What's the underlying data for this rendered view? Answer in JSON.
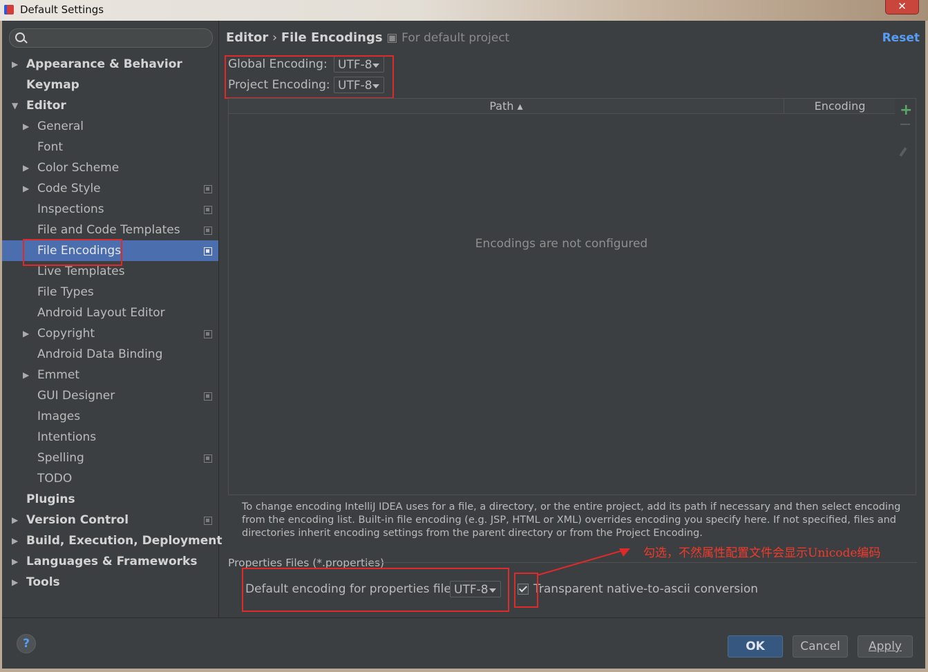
{
  "window": {
    "title": "Default Settings",
    "close_glyph": "✕"
  },
  "sidebar": {
    "search_placeholder": "",
    "items": [
      {
        "label": "Appearance & Behavior"
      },
      {
        "label": "Keymap"
      },
      {
        "label": "Editor"
      },
      {
        "label": "General"
      },
      {
        "label": "Font"
      },
      {
        "label": "Color Scheme"
      },
      {
        "label": "Code Style"
      },
      {
        "label": "Inspections"
      },
      {
        "label": "File and Code Templates"
      },
      {
        "label": "File Encodings"
      },
      {
        "label": "Live Templates"
      },
      {
        "label": "File Types"
      },
      {
        "label": "Android Layout Editor"
      },
      {
        "label": "Copyright"
      },
      {
        "label": "Android Data Binding"
      },
      {
        "label": "Emmet"
      },
      {
        "label": "GUI Designer"
      },
      {
        "label": "Images"
      },
      {
        "label": "Intentions"
      },
      {
        "label": "Spelling"
      },
      {
        "label": "TODO"
      },
      {
        "label": "Plugins"
      },
      {
        "label": "Version Control"
      },
      {
        "label": "Build, Execution, Deployment"
      },
      {
        "label": "Languages & Frameworks"
      },
      {
        "label": "Tools"
      }
    ],
    "selected": "File Encodings"
  },
  "breadcrumb": {
    "parent": "Editor",
    "separator": "›",
    "current": "File Encodings",
    "scope": "For default project"
  },
  "reset_label": "Reset",
  "encodings": {
    "global_label": "Global Encoding:",
    "global_value": "UTF-8",
    "project_label": "Project Encoding:",
    "project_value": "UTF-8"
  },
  "table": {
    "col_path": "Path",
    "col_path_sort": "▴",
    "col_encoding": "Encoding",
    "empty_message": "Encodings are not configured"
  },
  "help_text": "To change encoding IntelliJ IDEA uses for a file, a directory, or the entire project, add its path if necessary and then select encoding from the encoding list. Built-in file encoding (e.g. JSP, HTML or XML) overrides encoding you specify here. If not specified, files and directories inherit encoding settings from the parent directory or from the Project Encoding.",
  "properties": {
    "section_title": "Properties Files (*.properties)",
    "default_label": "Default encoding for properties files:",
    "default_value": "UTF-8",
    "transparent_label": "Transparent native-to-ascii conversion",
    "transparent_checked": true
  },
  "annotation": "勾选，不然属性配置文件会显示Unicode编码",
  "footer": {
    "help_glyph": "?",
    "ok": "OK",
    "cancel": "Cancel",
    "apply": "Apply"
  },
  "colors": {
    "accent": "#4b6eaf",
    "annotation": "#e02a2a",
    "link": "#589df6"
  }
}
